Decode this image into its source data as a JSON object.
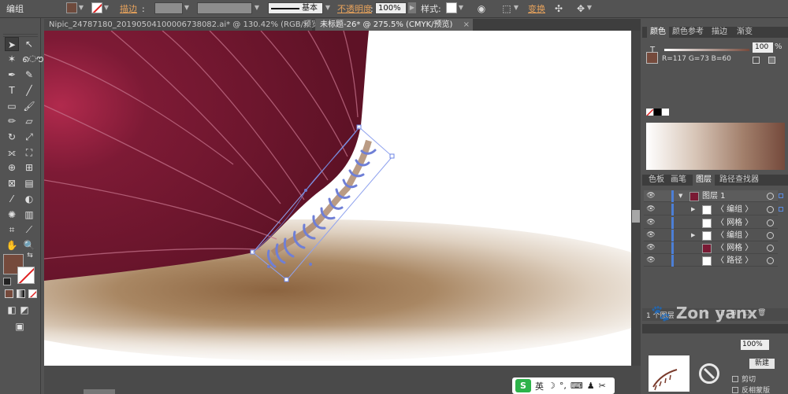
{
  "control_bar": {
    "object_type": "编组",
    "stroke_label": "描边",
    "stroke_profile": "基本",
    "opacity_label": "不透明度",
    "opacity_value": "100%",
    "style_label": "样式",
    "transform_label": "变换",
    "fill_color": "#6e4a3c"
  },
  "document_tabs": [
    {
      "label": "Nipic_24787180_20190504100006738082.ai* @ 130.42% (RGB/预览)"
    },
    {
      "label": "未标题-26* @ 275.5% (CMYK/预览)"
    }
  ],
  "color_panel": {
    "tabs": [
      "颜色",
      "颜色参考",
      "描边",
      "渐变"
    ],
    "t_label": "T",
    "t_value": "100",
    "rgb_readout": "R=117 G=73 B=60",
    "current_color": "#754a3c"
  },
  "layers_panel": {
    "tabs": [
      "色板",
      "画笔",
      "图层",
      "路径查找器"
    ],
    "rows": [
      {
        "label": "图层 1",
        "thumb": "#7a1a34"
      },
      {
        "label": "〈 编组 〉",
        "thumb": "#ffffff"
      },
      {
        "label": "〈 网格 〉",
        "thumb": "#ffffff"
      },
      {
        "label": "〈 编组 〉",
        "thumb": "#ffffff"
      },
      {
        "label": "〈 网格 〉",
        "thumb": "#7a1a34"
      },
      {
        "label": "〈 路径 〉",
        "thumb": "#ffffff"
      }
    ],
    "footer_count": "1 个图层"
  },
  "props_panel": {
    "opacity_value": "100%",
    "fill_label": "新建",
    "clip_label": "剪切",
    "invert_label": "反相蒙版"
  },
  "ime": {
    "logo": "S",
    "lang": "英"
  },
  "watermark": "Zon    yanx"
}
